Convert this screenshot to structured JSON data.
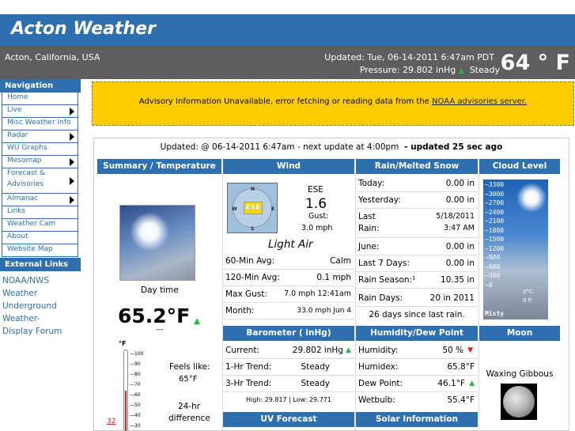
{
  "site_title": "Acton Weather",
  "location": "Acton, California, USA",
  "updated": "Updated:  Tue, 06-14-2011 6:47am PDT",
  "pressure_line": "Pressure: 29.802 inHg",
  "pressure_trend": "Steady",
  "current_temp": "64 ° F",
  "nav": {
    "heading": "Navigation",
    "items": [
      {
        "label": "Home"
      },
      {
        "label": "Live"
      },
      {
        "label": "Misc Weather Info"
      },
      {
        "label": "Radar"
      },
      {
        "label": "WU Graphs"
      },
      {
        "label": "Mesomap"
      },
      {
        "label": "Forecast &"
      },
      {
        "label": "Advisories"
      },
      {
        "label": "Almanac"
      },
      {
        "label": "Links"
      },
      {
        "label": "Weather Cam"
      },
      {
        "label": "About"
      },
      {
        "label": "Website Map"
      }
    ],
    "external_heading": "External Links",
    "external": [
      "NOAA/NWS",
      "Weather",
      "Underground",
      "Weather-",
      "Display Forum"
    ]
  },
  "advisory": {
    "text": "Advisory Information Unavailable, error fetching or reading data from the",
    "link": "NOAA advisories server."
  },
  "panel": {
    "update_line": "Updated: @ 06-14-2011 6:47am - next update at 4:00pm",
    "update_age": "- updated 25 sec ago",
    "headers": {
      "summary": "Summary / Temperature",
      "wind": "Wind",
      "rain": "Rain/Melted Snow",
      "cloud": "Cloud Level",
      "barometer": "Barometer ( inHg)",
      "humidity": "Humidity/Dew Point",
      "moon": "Moon",
      "uv": "UV Forecast",
      "solar": "Solar Information"
    },
    "summary": {
      "condition": "Day time",
      "temp": "65.2°F",
      "temp_sub": "---",
      "feels_label": "Feels like:",
      "feels_value": "65°F",
      "diff_label1": "24-hr",
      "diff_label2": "difference",
      "thermo_unit": "°F",
      "thermo_ticks": [
        "100",
        "90",
        "80",
        "70",
        "60",
        "50",
        "40",
        "30"
      ],
      "thermo_marker": "32"
    },
    "wind": {
      "dir": "ESE",
      "compass_label": "ESE",
      "compass_n": "N",
      "compass_s": "S",
      "compass_e": "E",
      "compass_w": "W",
      "speed": "1.6",
      "gust_label": "Gust:",
      "gust_value": "3.0 mph",
      "desc": "Light Air",
      "rows": [
        {
          "label": "60-Min Avg:",
          "value": "Calm"
        },
        {
          "label": "120-Min Avg:",
          "value": "0.1 mph"
        },
        {
          "label": "Max Gust:",
          "value": "7.0 mph 12:41am"
        },
        {
          "label": "Month:",
          "value": "33.0 mph Jun 4"
        }
      ]
    },
    "rain": {
      "rows": [
        {
          "label": "Today:",
          "value": "0.00 in"
        },
        {
          "label": "Yesterday:",
          "value": "0.00 in"
        }
      ],
      "last_label1": "Last",
      "last_label2": "Rain:",
      "last_date": "5/18/2011",
      "last_time": "3:47 AM",
      "rows2": [
        {
          "label": "June:",
          "value": "0.00 in"
        },
        {
          "label": "Last 7 Days:",
          "value": "0.00 in"
        },
        {
          "label": "Rain Season:¹",
          "value": "10.35 in"
        },
        {
          "label": "Rain Days:",
          "value": "20 in 2011"
        }
      ],
      "since": "26 days since last rain."
    },
    "cloud": {
      "ticks": [
        "3300",
        "3000",
        "2700",
        "2400",
        "2100",
        "1800",
        "1500",
        "1200",
        "900",
        "600",
        "300",
        "0"
      ],
      "right_labels": [
        "0°C",
        "0 ft"
      ],
      "caption": "Misty"
    },
    "barometer": {
      "rows": [
        {
          "label": "Current:",
          "value": "29.802 inHg"
        },
        {
          "label": "1-Hr Trend:",
          "value": "Steady"
        },
        {
          "label": "3-Hr Trend:",
          "value": "Steady"
        }
      ],
      "hilo": "High: 29.817  | Low: 29.771"
    },
    "humidity": {
      "rows": [
        {
          "label": "Humidity:",
          "value": "50 %"
        },
        {
          "label": "Humidex:",
          "value": "65.8°F"
        },
        {
          "label": "Dew Point:",
          "value": "46.1°F"
        },
        {
          "label": "Wetbulb:",
          "value": "55.4°F"
        }
      ]
    },
    "moon": {
      "phase": "Waxing Gibbous"
    }
  }
}
